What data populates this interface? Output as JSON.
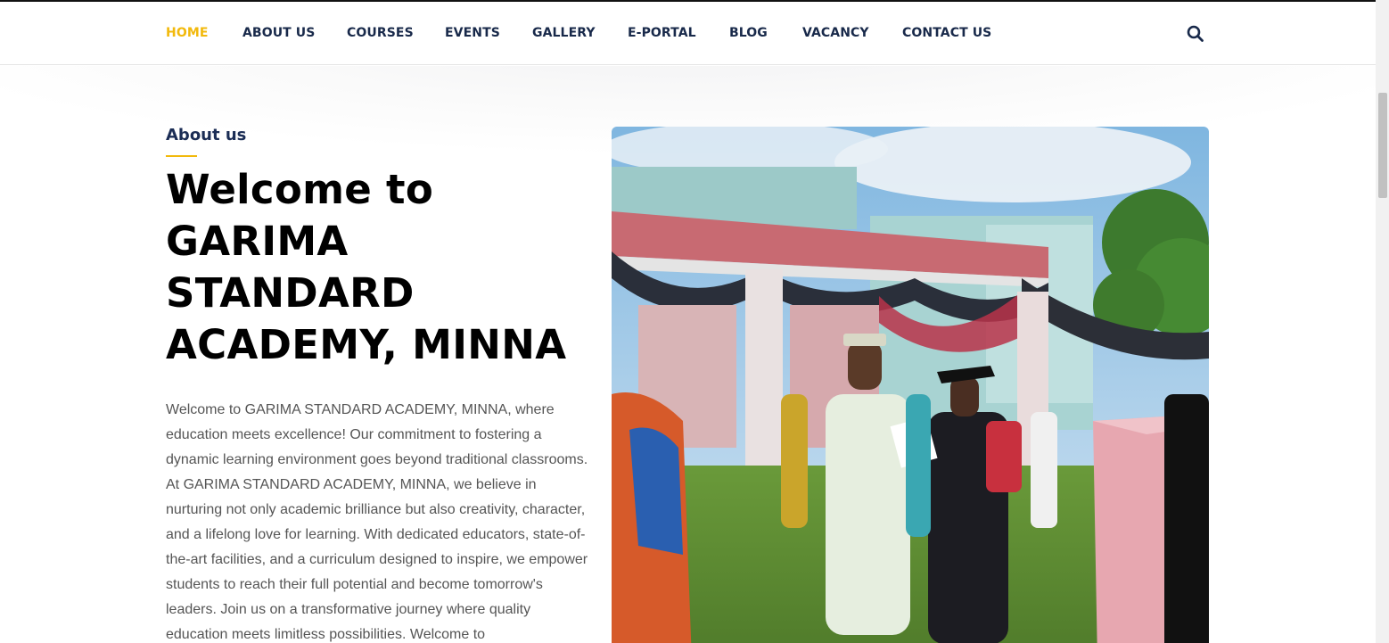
{
  "nav": {
    "items": [
      {
        "label": "HOME",
        "active": true
      },
      {
        "label": "ABOUT US"
      },
      {
        "label": "COURSES"
      },
      {
        "label": "EVENTS"
      },
      {
        "label": "GALLERY"
      },
      {
        "label": "E-PORTAL"
      },
      {
        "label": "BLOG"
      },
      {
        "label": "VACANCY"
      },
      {
        "label": "CONTACT US"
      }
    ],
    "search_icon": "search-icon"
  },
  "about": {
    "eyebrow": "About us",
    "headline": [
      "Welcome to",
      "GARIMA",
      "STANDARD",
      "ACADEMY, MINNA"
    ],
    "paragraph": "Welcome to GARIMA STANDARD ACADEMY, MINNA, where education meets excellence! Our commitment to fostering a dynamic learning environment goes beyond traditional classrooms. At GARIMA STANDARD ACADEMY, MINNA, we believe in nurturing not only academic brilliance but also creativity, character, and a lifelong love for learning. With dedicated educators, state-of-the-art facilities, and a curriculum designed to inspire, we empower students to reach their full potential and become tomorrow's leaders. Join us on a transformative journey where quality education meets limitless possibilities. Welcome to"
  },
  "colors": {
    "accent": "#f2b90c",
    "nav_text": "#18294a",
    "heading": "#000000",
    "body_text": "#555555"
  }
}
